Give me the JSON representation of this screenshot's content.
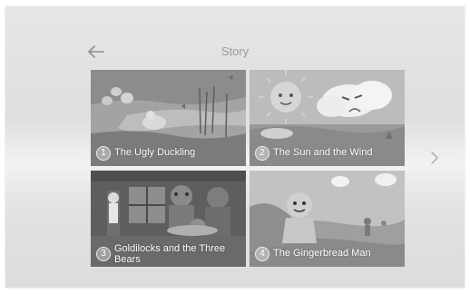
{
  "header": {
    "title": "Story",
    "back_icon": "arrow-left-icon",
    "next_icon": "chevron-right-icon"
  },
  "stories": [
    {
      "number": "1",
      "title": "The Ugly Duckling"
    },
    {
      "number": "2",
      "title": "The Sun and the Wind"
    },
    {
      "number": "3",
      "title": "Goldilocks and the Three Bears"
    },
    {
      "number": "4",
      "title": "The Gingerbread Man"
    }
  ],
  "colors": {
    "text_muted": "#9a9a9a",
    "label": "#ffffff"
  }
}
